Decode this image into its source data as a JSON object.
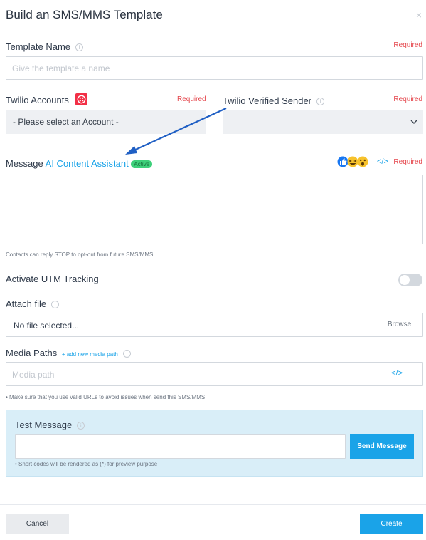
{
  "header": {
    "title": "Build an SMS/MMS Template",
    "close": "×"
  },
  "template_name": {
    "label": "Template Name",
    "required": "Required",
    "placeholder": "Give the template a name"
  },
  "twilio_accounts": {
    "label": "Twilio Accounts",
    "required": "Required",
    "value": "- Please select an Account -"
  },
  "verified_sender": {
    "label": "Twilio Verified Sender",
    "required": "Required",
    "value": ""
  },
  "message": {
    "label": "Message",
    "assistant_link": "AI Content Assistant",
    "badge": "Active",
    "code_icon_text": "</>",
    "required": "Required",
    "emoji_icons": [
      "thumbs-up-icon",
      "laughing-icon",
      "surprised-icon"
    ],
    "note": "Contacts can reply STOP to opt-out from future SMS/MMS"
  },
  "utm": {
    "label": "Activate UTM Tracking",
    "enabled": false
  },
  "attach": {
    "label": "Attach file",
    "value": "No file selected...",
    "browse": "Browse"
  },
  "media": {
    "label": "Media Paths",
    "add_link": "+ add new media path",
    "placeholder": "Media path",
    "code_icon_text": "</>",
    "note": "• Make sure that you use valid URLs to avoid issues when send this SMS/MMS"
  },
  "test": {
    "label": "Test Message",
    "send_button": "Send Message",
    "note": "• Short codes will be rendered as (*) for preview purpose"
  },
  "footer": {
    "cancel": "Cancel",
    "create": "Create"
  },
  "colors": {
    "accent": "#1aa3e8",
    "required": "#e5474d",
    "twilio": "#f22f46",
    "badge": "#3ed07a",
    "annotation_arrow": "#1f5fc4"
  }
}
